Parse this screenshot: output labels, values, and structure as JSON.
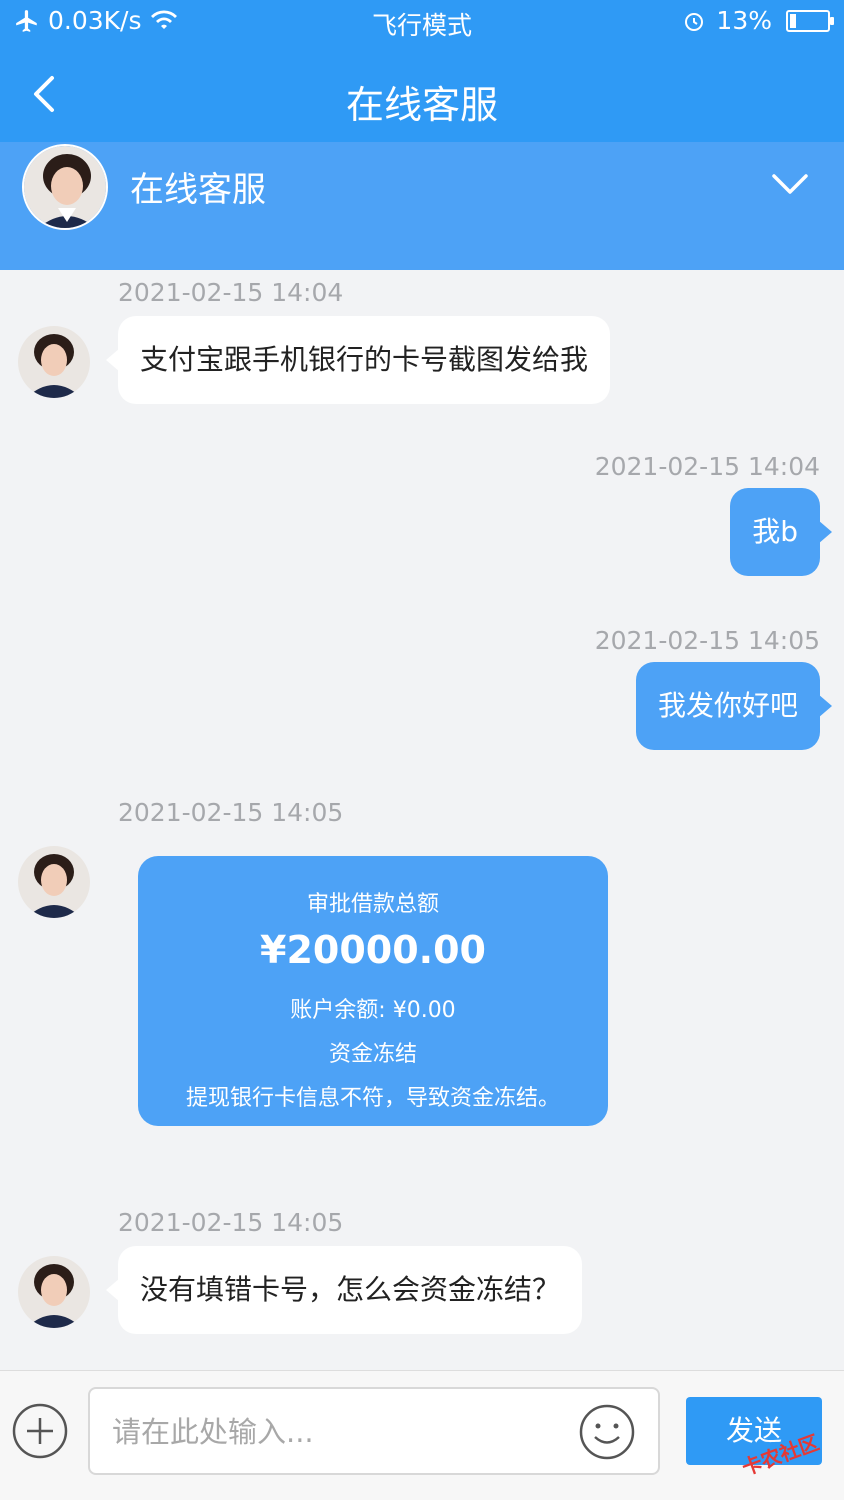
{
  "status_bar": {
    "network_speed": "0.03K/s",
    "mode": "飞行模式",
    "battery": "13%"
  },
  "nav": {
    "title": "在线客服"
  },
  "agent": {
    "name": "在线客服"
  },
  "messages": [
    {
      "time": "2021-02-15 14:04",
      "text": "支付宝跟手机银行的卡号截图发给我"
    },
    {
      "time": "2021-02-15 14:04",
      "text": "我b"
    },
    {
      "time": "2021-02-15 14:05",
      "text": "我发你好吧"
    },
    {
      "time": "2021-02-15 14:05"
    },
    {
      "time": "2021-02-15 14:05",
      "text": "没有填错卡号，怎么会资金冻结？"
    }
  ],
  "card": {
    "label": "审批借款总额",
    "amount": "¥20000.00",
    "balance": "账户余额: ¥0.00",
    "status": "资金冻结",
    "reason": "提现银行卡信息不符，导致资金冻结。"
  },
  "input": {
    "placeholder": "请在此处输入..."
  },
  "send_label": "发送",
  "watermark": "卡农社区",
  "colors": {
    "primary": "#2f9af5",
    "bubble_out": "#4da2f6",
    "background": "#f2f3f5"
  }
}
